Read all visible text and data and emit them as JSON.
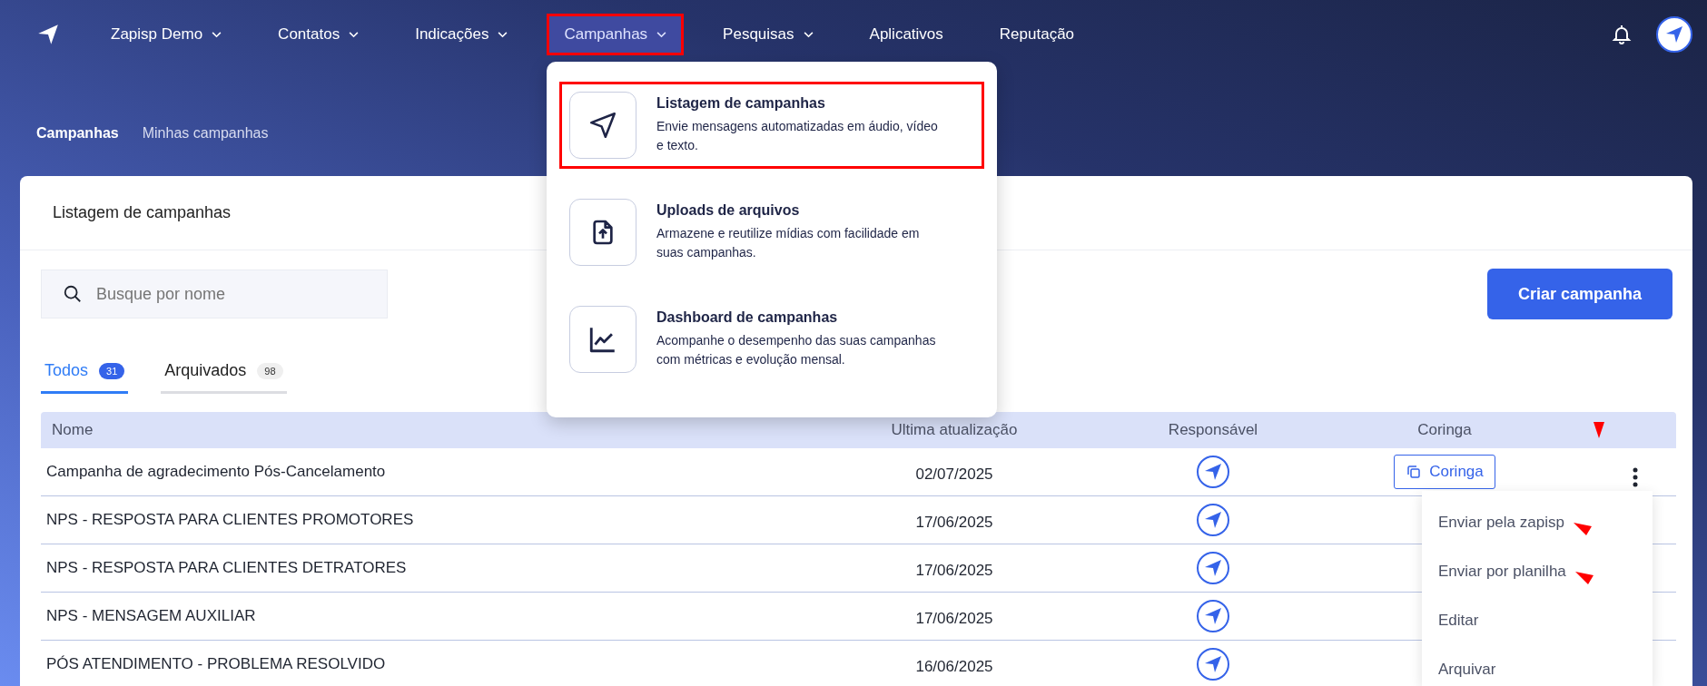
{
  "nav": {
    "items": [
      {
        "label": "Zapisp Demo",
        "dropdown": true,
        "selected": false,
        "highlighted": false
      },
      {
        "label": "Contatos",
        "dropdown": true,
        "selected": false,
        "highlighted": false
      },
      {
        "label": "Indicações",
        "dropdown": true,
        "selected": false,
        "highlighted": false
      },
      {
        "label": "Campanhas",
        "dropdown": true,
        "selected": true,
        "highlighted": true
      },
      {
        "label": "Pesquisas",
        "dropdown": true,
        "selected": false,
        "highlighted": false
      },
      {
        "label": "Aplicativos",
        "dropdown": false,
        "selected": false,
        "highlighted": false
      },
      {
        "label": "Reputação",
        "dropdown": false,
        "selected": false,
        "highlighted": false
      }
    ]
  },
  "breadcrumb": [
    {
      "label": "Campanhas",
      "current": false
    },
    {
      "label": "Minhas campanhas",
      "current": true
    }
  ],
  "card": {
    "title": "Listagem de campanhas"
  },
  "search": {
    "placeholder": "Busque por nome"
  },
  "create_button": "Criar campanha",
  "tabs": [
    {
      "label": "Todos",
      "count": "31",
      "selected": true
    },
    {
      "label": "Arquivados",
      "count": "98",
      "selected": false
    }
  ],
  "table": {
    "columns": [
      "Nome",
      "Ultima atualização",
      "Responsável",
      "Coringa"
    ],
    "actions_arrow_marker": true,
    "rows": [
      {
        "name": "Campanha de agradecimento Pós-Cancelamento",
        "updated": "02/07/2025",
        "coringa": "Coringa"
      },
      {
        "name": "NPS - RESPOSTA PARA CLIENTES PROMOTORES",
        "updated": "17/06/2025"
      },
      {
        "name": "NPS - RESPOSTA PARA CLIENTES DETRATORES",
        "updated": "17/06/2025"
      },
      {
        "name": "NPS - MENSAGEM AUXILIAR",
        "updated": "17/06/2025"
      },
      {
        "name": "PÓS ATENDIMENTO - PROBLEMA RESOLVIDO",
        "updated": "16/06/2025"
      }
    ]
  },
  "nav_menu": {
    "items": [
      {
        "kind": "send",
        "title": "Listagem de campanhas",
        "description": "Envie mensagens automatizadas em áudio, vídeo e texto.",
        "highlighted": true
      },
      {
        "kind": "upload",
        "title": "Uploads de arquivos",
        "description": "Armazene e reutilize mídias com facilidade em suas campanhas.",
        "highlighted": false
      },
      {
        "kind": "chart",
        "title": "Dashboard de campanhas",
        "description": "Acompanhe o desempenho das suas campanhas com métricas e evolução mensal.",
        "highlighted": false
      }
    ]
  },
  "row_menu": {
    "items": [
      {
        "label": "Enviar pela zapisp",
        "arrow_marker": true
      },
      {
        "label": "Enviar por planilha",
        "arrow_marker": true
      },
      {
        "label": "Editar",
        "arrow_marker": false
      },
      {
        "label": "Arquivar",
        "arrow_marker": false
      }
    ]
  }
}
